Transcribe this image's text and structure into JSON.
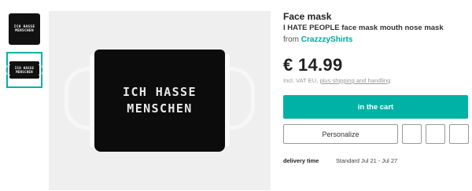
{
  "thumbnails": [
    {
      "text_line1": "ICH HASSE",
      "text_line2": "MENSCHEN",
      "active": false
    },
    {
      "text_line1": "ICH HASSE",
      "text_line2": "MENSCHEN",
      "active": true
    }
  ],
  "main_image": {
    "text_line1": "ICH HASSE",
    "text_line2": "MENSCHEN"
  },
  "product": {
    "type": "Face mask",
    "title": "I HATE PEOPLE face mask mouth nose mask",
    "from_label": "from",
    "shop": "CrazzzyShirts",
    "price": "€ 14.99",
    "vat_prefix": "Incl. VAT EU,",
    "vat_link": "plus shipping and handling"
  },
  "actions": {
    "cart_label": "in the cart",
    "personalize_label": "Personalize"
  },
  "delivery": {
    "label": "delivery time",
    "value": "Standard Jul 21 - Jul 27"
  },
  "colors": {
    "accent": "#00b2a5",
    "mask": "#0c0c0c",
    "background": "#efefef"
  }
}
